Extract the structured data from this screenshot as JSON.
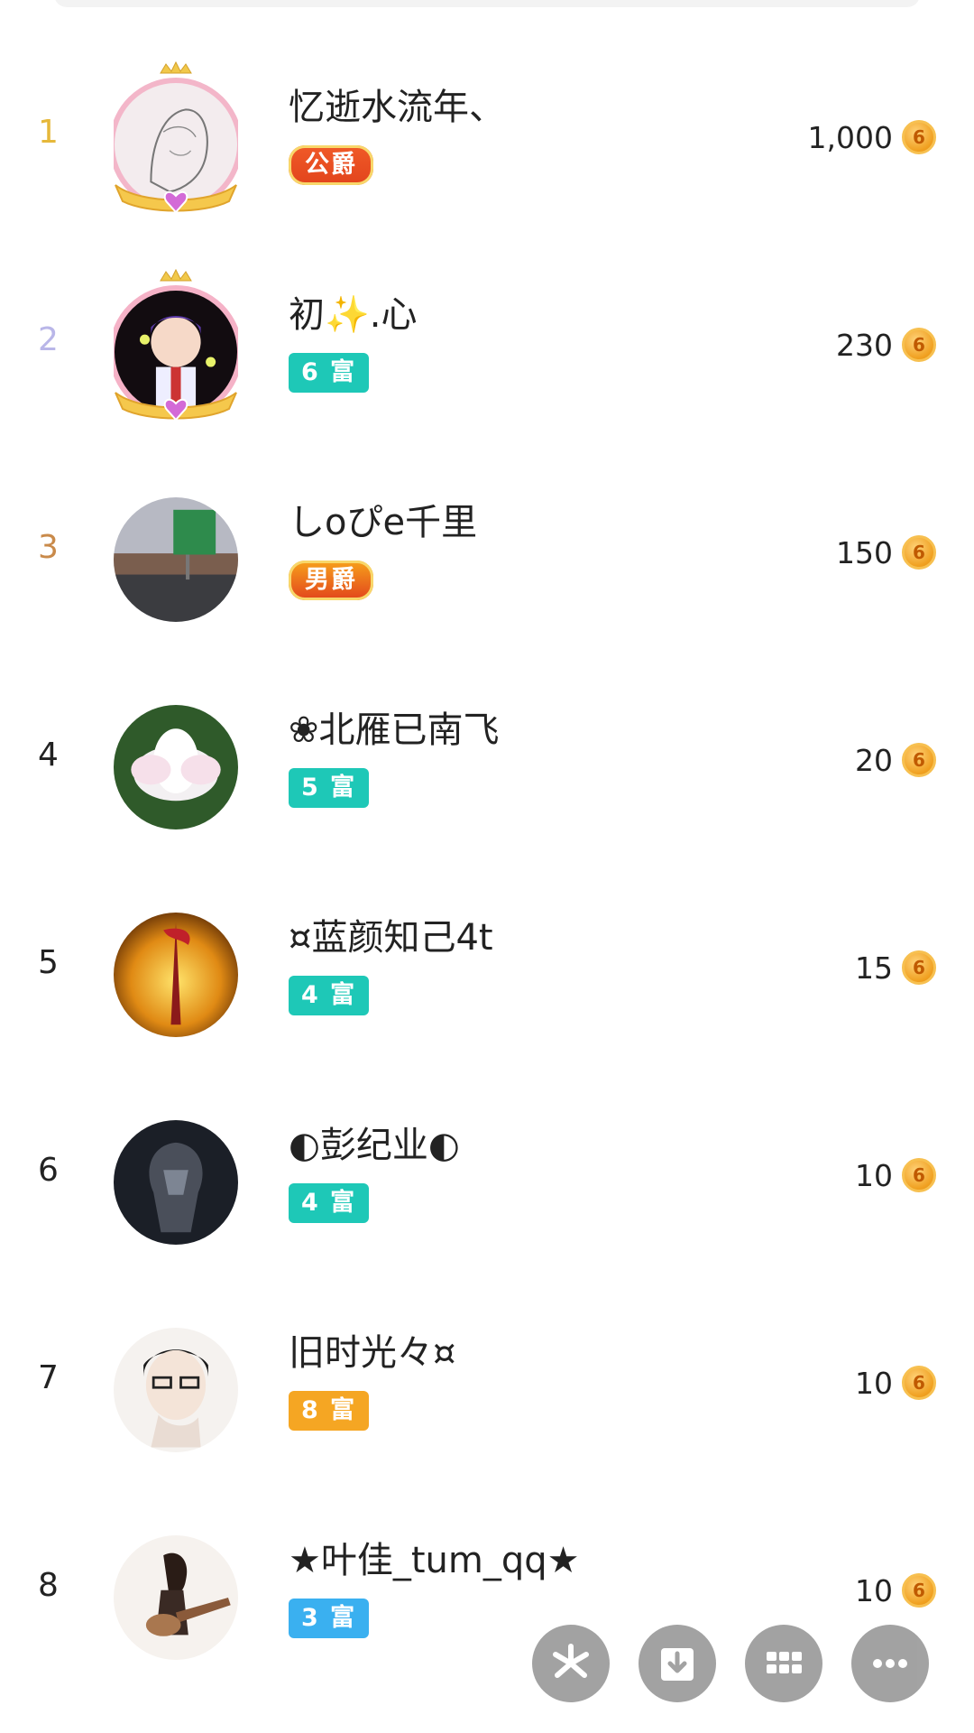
{
  "leaderboard": {
    "rows": [
      {
        "rank": "1",
        "rank_color": "#e6b83a",
        "name": "忆逝水流年、",
        "badge": "公爵",
        "badge_style": "title",
        "badge_color": "#f05a28",
        "score": "1,000"
      },
      {
        "rank": "2",
        "rank_color": "#b9b6e8",
        "name": "初✨.心",
        "badge": "6 富",
        "badge_style": "level",
        "badge_color": "#1ec8b7",
        "score": "230"
      },
      {
        "rank": "3",
        "rank_color": "#c98a4a",
        "name": "しoぴe千里",
        "badge": "男爵",
        "badge_style": "title",
        "badge_color": "#f7a21b",
        "score": "150"
      },
      {
        "rank": "4",
        "rank_color": "#222222",
        "name": "❀北雁已南飞",
        "badge": "5 富",
        "badge_style": "level",
        "badge_color": "#1ec8b7",
        "score": "20"
      },
      {
        "rank": "5",
        "rank_color": "#222222",
        "name": "¤蓝颜知己4t",
        "badge": "4 富",
        "badge_style": "level",
        "badge_color": "#1ec8b7",
        "score": "15"
      },
      {
        "rank": "6",
        "rank_color": "#222222",
        "name": "◐彭纪业◐",
        "badge": "4 富",
        "badge_style": "level",
        "badge_color": "#1ec8b7",
        "score": "10"
      },
      {
        "rank": "7",
        "rank_color": "#222222",
        "name": "旧时光々¤",
        "badge": "8 富",
        "badge_style": "level",
        "badge_color": "#f5a623",
        "score": "10"
      },
      {
        "rank": "8",
        "rank_color": "#222222",
        "name": "★叶佳_tum_qq★",
        "badge": "3 富",
        "badge_style": "level",
        "badge_color": "#3ab0f0",
        "score": "10"
      }
    ],
    "coin_icon": "coin-icon",
    "coin_glyph": "6"
  },
  "fab_actions": [
    {
      "icon": "pinwheel-icon"
    },
    {
      "icon": "download-icon"
    },
    {
      "icon": "grid-icon"
    },
    {
      "icon": "more-icon"
    }
  ]
}
